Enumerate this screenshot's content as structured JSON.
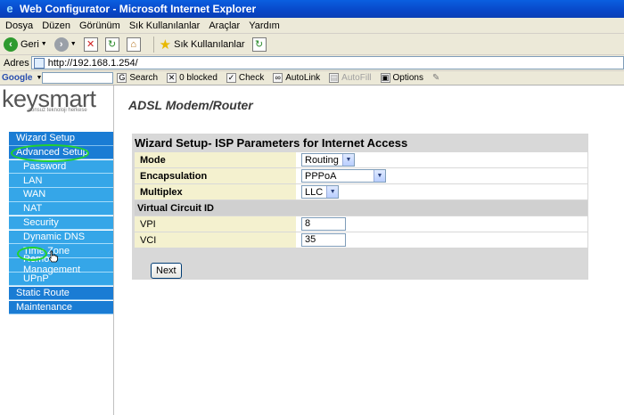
{
  "window": {
    "title": "Web Configurator - Microsoft Internet Explorer"
  },
  "menubar": [
    "Dosya",
    "Düzen",
    "Görünüm",
    "Sık Kullanılanlar",
    "Araçlar",
    "Yardım"
  ],
  "toolbar": {
    "back_label": "Geri",
    "favorites_label": "Sık Kullanılanlar"
  },
  "address": {
    "label": "Adres",
    "url": "http://192.168.1.254/"
  },
  "google_toolbar": {
    "logo": "Google",
    "search": "Search",
    "blocked": "0 blocked",
    "check": "Check",
    "autolink": "AutoLink",
    "autofill": "AutoFill",
    "options": "Options"
  },
  "brand": {
    "name_a": "key",
    "name_b": "smart",
    "tagline": "sonsuz teknoloji herkese"
  },
  "nav": {
    "wizard": "Wizard Setup",
    "advanced": "Advanced Setup",
    "password": "Password",
    "lan": "LAN",
    "wan": "WAN",
    "nat": "NAT",
    "security": "Security",
    "ddns": "Dynamic DNS",
    "timezone": "Time Zone",
    "remote": "Remote Management",
    "upnp": "UPnP",
    "static_route": "Static Route",
    "maintenance": "Maintenance"
  },
  "main": {
    "title": "ADSL Modem/Router",
    "panel_title": "Wizard Setup- ISP Parameters for Internet Access",
    "mode_label": "Mode",
    "mode_value": "Routing",
    "encap_label": "Encapsulation",
    "encap_value": "PPPoA",
    "multiplex_label": "Multiplex",
    "multiplex_value": "LLC",
    "vc_section": "Virtual Circuit ID",
    "vpi_label": "VPI",
    "vpi_value": "8",
    "vci_label": "VCI",
    "vci_value": "35",
    "next_button": "Next"
  }
}
